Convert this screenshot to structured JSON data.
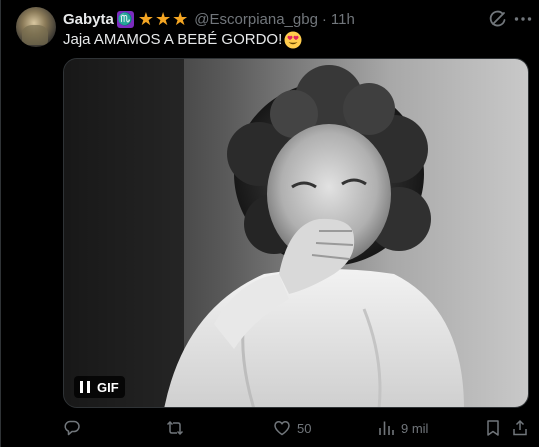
{
  "tweet": {
    "author_name": "Gabyta",
    "zodiac_badge": "♏",
    "stars": "★★★",
    "handle": "@Escorpiana_gbg",
    "separator": "·",
    "time": "11h",
    "text": "Jaja AMAMOS A BEBÉ GORDO!",
    "text_emoji": "smiling-face-with-heart-eyes-icon"
  },
  "media": {
    "type": "gif",
    "badge_label": "GIF",
    "pause_icon": "pause-icon"
  },
  "actions": {
    "reply": {
      "icon": "reply-icon",
      "count": ""
    },
    "repost": {
      "icon": "repost-icon",
      "count": ""
    },
    "like": {
      "icon": "heart-icon",
      "count": "50"
    },
    "views": {
      "icon": "views-icon",
      "count": "9 mil"
    },
    "bookmark": {
      "icon": "bookmark-icon",
      "count": ""
    },
    "share": {
      "icon": "share-icon",
      "count": ""
    }
  },
  "top_icons": {
    "grok": "grok-icon",
    "more": "more-icon"
  },
  "colors": {
    "background": "#000000",
    "text_primary": "#e7e9ea",
    "text_secondary": "#71767b",
    "stars": "#f5a623",
    "zodiac_badge": "#7b2cbf"
  }
}
